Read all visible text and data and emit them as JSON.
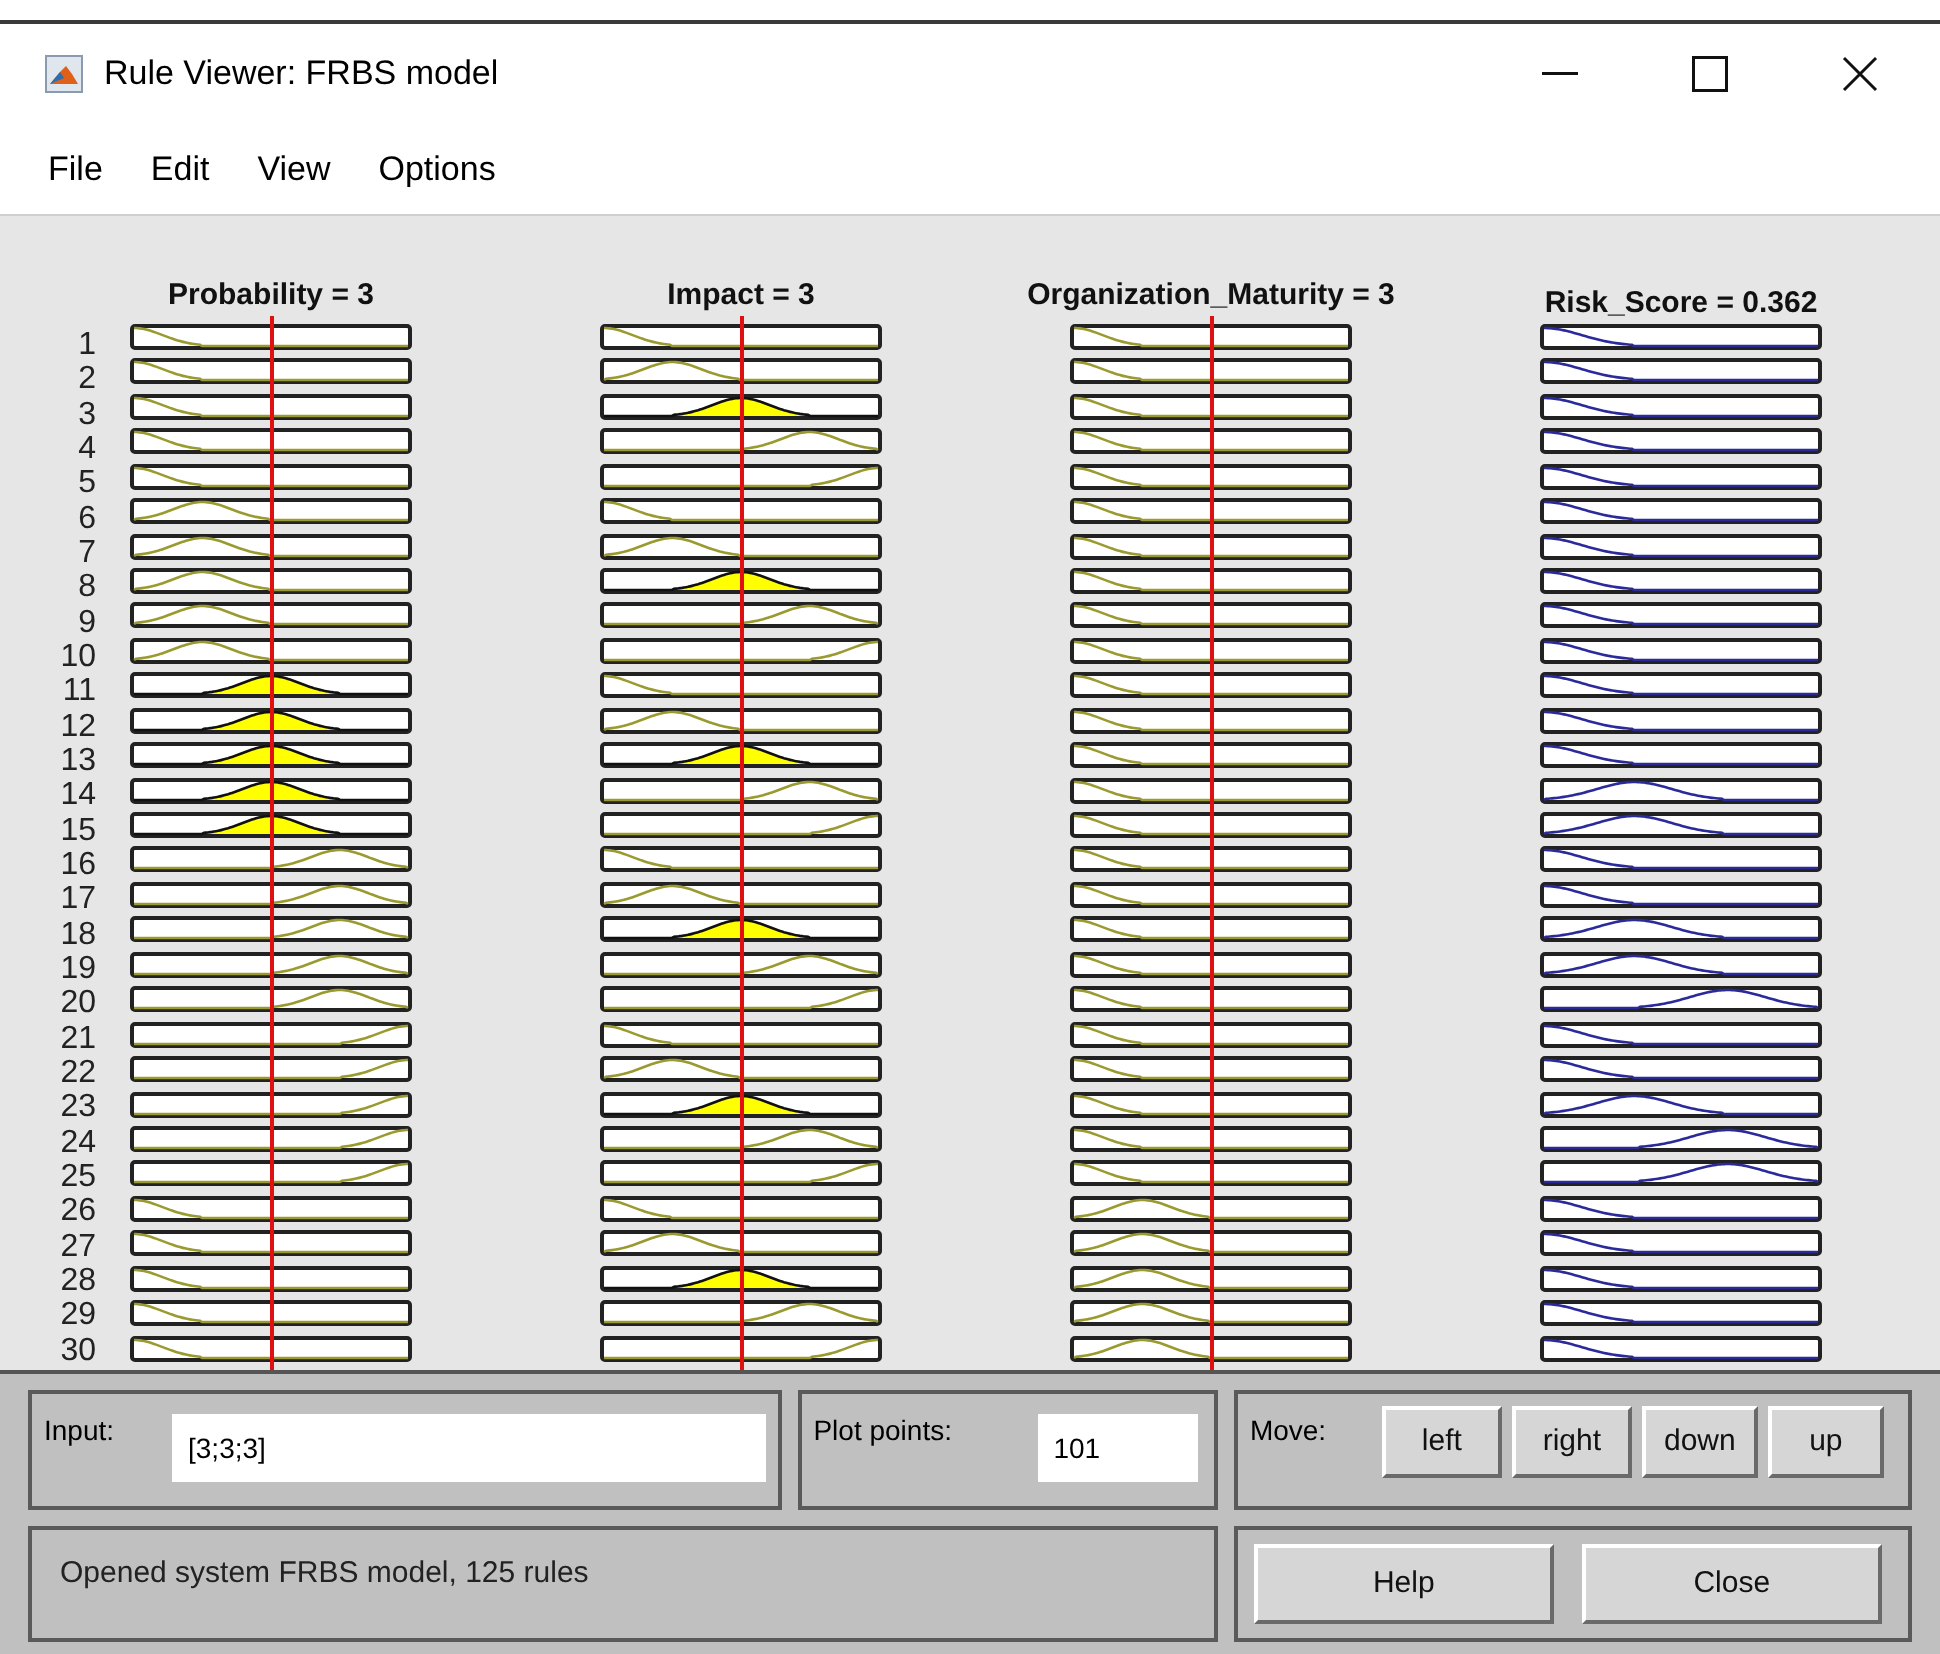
{
  "window": {
    "title": "Rule Viewer: FRBS model"
  },
  "menu": [
    "File",
    "Edit",
    "View",
    "Options"
  ],
  "variables": [
    {
      "label": "Probability = 3",
      "kind": "input"
    },
    {
      "label": "Impact = 3",
      "kind": "input"
    },
    {
      "label": "Organization_Maturity = 3",
      "kind": "input"
    },
    {
      "label": "Risk_Score = 0.362",
      "kind": "output"
    }
  ],
  "rules": [
    {
      "number": "1",
      "cells": [
        {
          "kind": "mf1",
          "fired": false
        },
        {
          "kind": "mf1",
          "fired": false
        },
        {
          "kind": "mf1",
          "fired": false
        },
        {
          "kind": "mf1",
          "fired": false
        }
      ]
    },
    {
      "number": "2",
      "cells": [
        {
          "kind": "mf1",
          "fired": false
        },
        {
          "kind": "mf2",
          "fired": false
        },
        {
          "kind": "mf1",
          "fired": false
        },
        {
          "kind": "mf1",
          "fired": false
        }
      ]
    },
    {
      "number": "3",
      "cells": [
        {
          "kind": "mf1",
          "fired": false
        },
        {
          "kind": "mf3",
          "fired": true
        },
        {
          "kind": "mf1",
          "fired": false
        },
        {
          "kind": "mf1",
          "fired": false
        }
      ]
    },
    {
      "number": "4",
      "cells": [
        {
          "kind": "mf1",
          "fired": false
        },
        {
          "kind": "mf4",
          "fired": false
        },
        {
          "kind": "mf1",
          "fired": false
        },
        {
          "kind": "mf1",
          "fired": false
        }
      ]
    },
    {
      "number": "5",
      "cells": [
        {
          "kind": "mf1",
          "fired": false
        },
        {
          "kind": "mf5",
          "fired": false
        },
        {
          "kind": "mf1",
          "fired": false
        },
        {
          "kind": "mf1",
          "fired": false
        }
      ]
    },
    {
      "number": "6",
      "cells": [
        {
          "kind": "mf2",
          "fired": false
        },
        {
          "kind": "mf1",
          "fired": false
        },
        {
          "kind": "mf1",
          "fired": false
        },
        {
          "kind": "mf1",
          "fired": false
        }
      ]
    },
    {
      "number": "7",
      "cells": [
        {
          "kind": "mf2",
          "fired": false
        },
        {
          "kind": "mf2",
          "fired": false
        },
        {
          "kind": "mf1",
          "fired": false
        },
        {
          "kind": "mf1",
          "fired": false
        }
      ]
    },
    {
      "number": "8",
      "cells": [
        {
          "kind": "mf2",
          "fired": false
        },
        {
          "kind": "mf3",
          "fired": true
        },
        {
          "kind": "mf1",
          "fired": false
        },
        {
          "kind": "mf1",
          "fired": false
        }
      ]
    },
    {
      "number": "9",
      "cells": [
        {
          "kind": "mf2",
          "fired": false
        },
        {
          "kind": "mf4",
          "fired": false
        },
        {
          "kind": "mf1",
          "fired": false
        },
        {
          "kind": "mf1",
          "fired": false
        }
      ]
    },
    {
      "number": "10",
      "cells": [
        {
          "kind": "mf2",
          "fired": false
        },
        {
          "kind": "mf5",
          "fired": false
        },
        {
          "kind": "mf1",
          "fired": false
        },
        {
          "kind": "mf1",
          "fired": false
        }
      ]
    },
    {
      "number": "11",
      "cells": [
        {
          "kind": "mf3",
          "fired": true
        },
        {
          "kind": "mf1",
          "fired": false
        },
        {
          "kind": "mf1",
          "fired": false
        },
        {
          "kind": "mf1",
          "fired": false
        }
      ]
    },
    {
      "number": "12",
      "cells": [
        {
          "kind": "mf3",
          "fired": true
        },
        {
          "kind": "mf2",
          "fired": false
        },
        {
          "kind": "mf1",
          "fired": false
        },
        {
          "kind": "mf1",
          "fired": false
        }
      ]
    },
    {
      "number": "13",
      "cells": [
        {
          "kind": "mf3",
          "fired": true
        },
        {
          "kind": "mf3",
          "fired": true
        },
        {
          "kind": "mf1",
          "fired": false
        },
        {
          "kind": "mf1",
          "fired": false
        }
      ]
    },
    {
      "number": "14",
      "cells": [
        {
          "kind": "mf3",
          "fired": true
        },
        {
          "kind": "mf4",
          "fired": false
        },
        {
          "kind": "mf1",
          "fired": false
        },
        {
          "kind": "mf2",
          "fired": false
        }
      ]
    },
    {
      "number": "15",
      "cells": [
        {
          "kind": "mf3",
          "fired": true
        },
        {
          "kind": "mf5",
          "fired": false
        },
        {
          "kind": "mf1",
          "fired": false
        },
        {
          "kind": "mf2",
          "fired": false
        }
      ]
    },
    {
      "number": "16",
      "cells": [
        {
          "kind": "mf4",
          "fired": false
        },
        {
          "kind": "mf1",
          "fired": false
        },
        {
          "kind": "mf1",
          "fired": false
        },
        {
          "kind": "mf1",
          "fired": false
        }
      ]
    },
    {
      "number": "17",
      "cells": [
        {
          "kind": "mf4",
          "fired": false
        },
        {
          "kind": "mf2",
          "fired": false
        },
        {
          "kind": "mf1",
          "fired": false
        },
        {
          "kind": "mf1",
          "fired": false
        }
      ]
    },
    {
      "number": "18",
      "cells": [
        {
          "kind": "mf4",
          "fired": false
        },
        {
          "kind": "mf3",
          "fired": true
        },
        {
          "kind": "mf1",
          "fired": false
        },
        {
          "kind": "mf2",
          "fired": false
        }
      ]
    },
    {
      "number": "19",
      "cells": [
        {
          "kind": "mf4",
          "fired": false
        },
        {
          "kind": "mf4",
          "fired": false
        },
        {
          "kind": "mf1",
          "fired": false
        },
        {
          "kind": "mf2",
          "fired": false
        }
      ]
    },
    {
      "number": "20",
      "cells": [
        {
          "kind": "mf4",
          "fired": false
        },
        {
          "kind": "mf5",
          "fired": false
        },
        {
          "kind": "mf1",
          "fired": false
        },
        {
          "kind": "mf3",
          "fired": false
        }
      ]
    },
    {
      "number": "21",
      "cells": [
        {
          "kind": "mf5",
          "fired": false
        },
        {
          "kind": "mf1",
          "fired": false
        },
        {
          "kind": "mf1",
          "fired": false
        },
        {
          "kind": "mf1",
          "fired": false
        }
      ]
    },
    {
      "number": "22",
      "cells": [
        {
          "kind": "mf5",
          "fired": false
        },
        {
          "kind": "mf2",
          "fired": false
        },
        {
          "kind": "mf1",
          "fired": false
        },
        {
          "kind": "mf1",
          "fired": false
        }
      ]
    },
    {
      "number": "23",
      "cells": [
        {
          "kind": "mf5",
          "fired": false
        },
        {
          "kind": "mf3",
          "fired": true
        },
        {
          "kind": "mf1",
          "fired": false
        },
        {
          "kind": "mf2",
          "fired": false
        }
      ]
    },
    {
      "number": "24",
      "cells": [
        {
          "kind": "mf5",
          "fired": false
        },
        {
          "kind": "mf4",
          "fired": false
        },
        {
          "kind": "mf1",
          "fired": false
        },
        {
          "kind": "mf3",
          "fired": false
        }
      ]
    },
    {
      "number": "25",
      "cells": [
        {
          "kind": "mf5",
          "fired": false
        },
        {
          "kind": "mf5",
          "fired": false
        },
        {
          "kind": "mf1",
          "fired": false
        },
        {
          "kind": "mf3",
          "fired": false
        }
      ]
    },
    {
      "number": "26",
      "cells": [
        {
          "kind": "mf1",
          "fired": false
        },
        {
          "kind": "mf1",
          "fired": false
        },
        {
          "kind": "mf2",
          "fired": false
        },
        {
          "kind": "mf1",
          "fired": false
        }
      ]
    },
    {
      "number": "27",
      "cells": [
        {
          "kind": "mf1",
          "fired": false
        },
        {
          "kind": "mf2",
          "fired": false
        },
        {
          "kind": "mf2",
          "fired": false
        },
        {
          "kind": "mf1",
          "fired": false
        }
      ]
    },
    {
      "number": "28",
      "cells": [
        {
          "kind": "mf1",
          "fired": false
        },
        {
          "kind": "mf3",
          "fired": true
        },
        {
          "kind": "mf2",
          "fired": false
        },
        {
          "kind": "mf1",
          "fired": false
        }
      ]
    },
    {
      "number": "29",
      "cells": [
        {
          "kind": "mf1",
          "fired": false
        },
        {
          "kind": "mf4",
          "fired": false
        },
        {
          "kind": "mf2",
          "fired": false
        },
        {
          "kind": "mf1",
          "fired": false
        }
      ]
    },
    {
      "number": "30",
      "cells": [
        {
          "kind": "mf1",
          "fired": false
        },
        {
          "kind": "mf5",
          "fired": false
        },
        {
          "kind": "mf2",
          "fired": false
        },
        {
          "kind": "mf1",
          "fired": false
        }
      ]
    }
  ],
  "input": {
    "label": "Input:",
    "value": "[3;3;3]"
  },
  "plot_points": {
    "label": "Plot points:",
    "value": "101"
  },
  "move": {
    "label": "Move:",
    "buttons": [
      "left",
      "right",
      "down",
      "up"
    ]
  },
  "status": "Opened system FRBS model, 125 rules",
  "buttons": [
    "Help",
    "Close"
  ]
}
